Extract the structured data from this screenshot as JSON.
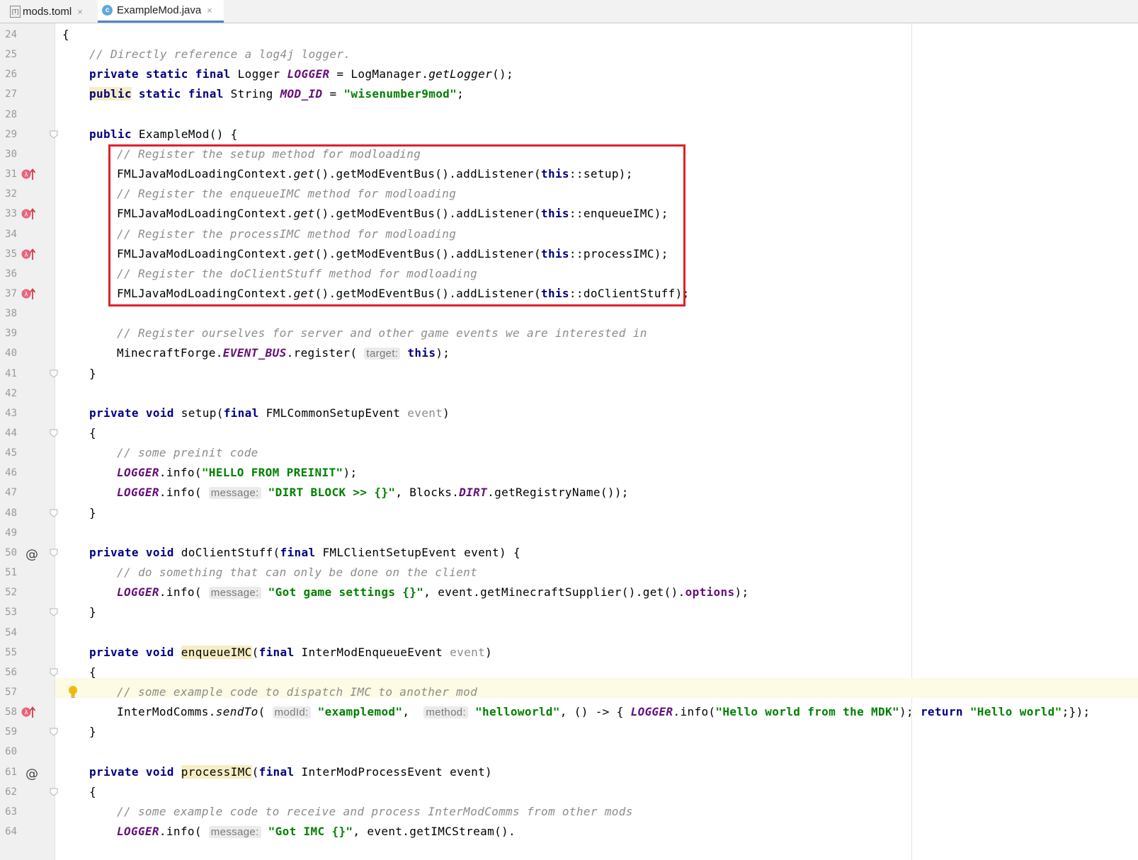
{
  "tabs": [
    {
      "label": "mods.toml",
      "icon": "toml-file-icon",
      "close": "×"
    },
    {
      "label": "ExampleMod.java",
      "icon": "java-class-icon",
      "close": "×",
      "active": true
    }
  ],
  "colors": {
    "keyword": "#000080",
    "string": "#008000",
    "comment": "#8c8c8c",
    "static_field": "#660e7a",
    "highlight_box": "#e0202a"
  },
  "lines": [
    {
      "n": "24",
      "indent": 0,
      "parts": [
        {
          "t": "{"
        }
      ]
    },
    {
      "n": "25",
      "indent": 1,
      "parts": [
        {
          "t": "// Directly reference a log4j logger.",
          "c": "cmt"
        }
      ]
    },
    {
      "n": "26",
      "indent": 1,
      "parts": [
        {
          "t": "private static final",
          "c": "kw"
        },
        {
          "t": " Logger "
        },
        {
          "t": "LOGGER",
          "c": "sf"
        },
        {
          "t": " = LogManager."
        },
        {
          "t": "getLogger",
          "c": "it"
        },
        {
          "t": "();"
        }
      ]
    },
    {
      "n": "27",
      "indent": 1,
      "parts": [
        {
          "t": "public",
          "c": "kw hlw"
        },
        {
          "t": " static final",
          "c": "kw"
        },
        {
          "t": " String "
        },
        {
          "t": "MOD_ID",
          "c": "sf"
        },
        {
          "t": " = "
        },
        {
          "t": "\"wisenumber9mod\"",
          "c": "str"
        },
        {
          "t": ";"
        }
      ]
    },
    {
      "n": "28",
      "indent": 0,
      "parts": []
    },
    {
      "n": "29",
      "indent": 1,
      "fold": true,
      "parts": [
        {
          "t": "public",
          "c": "kw"
        },
        {
          "t": " ExampleMod() {"
        }
      ]
    },
    {
      "n": "30",
      "indent": 2,
      "parts": [
        {
          "t": "// Register the setup method for modloading",
          "c": "cmt"
        }
      ]
    },
    {
      "n": "31",
      "indent": 2,
      "gutter": "lambda",
      "parts": [
        {
          "t": "FMLJavaModLoadingContext."
        },
        {
          "t": "get",
          "c": "it"
        },
        {
          "t": "().getModEventBus().addListener("
        },
        {
          "t": "this",
          "c": "kw"
        },
        {
          "t": "::setup);"
        }
      ]
    },
    {
      "n": "32",
      "indent": 2,
      "parts": [
        {
          "t": "// Register the enqueueIMC method for modloading",
          "c": "cmt"
        }
      ]
    },
    {
      "n": "33",
      "indent": 2,
      "gutter": "lambda",
      "parts": [
        {
          "t": "FMLJavaModLoadingContext."
        },
        {
          "t": "get",
          "c": "it"
        },
        {
          "t": "().getModEventBus().addListener("
        },
        {
          "t": "this",
          "c": "kw"
        },
        {
          "t": "::enqueueIMC);"
        }
      ]
    },
    {
      "n": "34",
      "indent": 2,
      "parts": [
        {
          "t": "// Register the processIMC method for modloading",
          "c": "cmt"
        }
      ]
    },
    {
      "n": "35",
      "indent": 2,
      "gutter": "lambda",
      "parts": [
        {
          "t": "FMLJavaModLoadingContext."
        },
        {
          "t": "get",
          "c": "it"
        },
        {
          "t": "().getModEventBus().addListener("
        },
        {
          "t": "this",
          "c": "kw"
        },
        {
          "t": "::processIMC);"
        }
      ]
    },
    {
      "n": "36",
      "indent": 2,
      "parts": [
        {
          "t": "// Register the doClientStuff method for modloading",
          "c": "cmt"
        }
      ]
    },
    {
      "n": "37",
      "indent": 2,
      "gutter": "lambda",
      "parts": [
        {
          "t": "FMLJavaModLoadingContext."
        },
        {
          "t": "get",
          "c": "it"
        },
        {
          "t": "().getModEventBus().addListener("
        },
        {
          "t": "this",
          "c": "kw"
        },
        {
          "t": "::doClientStuff);"
        }
      ]
    },
    {
      "n": "38",
      "indent": 0,
      "parts": []
    },
    {
      "n": "39",
      "indent": 2,
      "parts": [
        {
          "t": "// Register ourselves for server and other game events we are interested in",
          "c": "cmt"
        }
      ]
    },
    {
      "n": "40",
      "indent": 2,
      "parts": [
        {
          "t": "MinecraftForge."
        },
        {
          "t": "EVENT_BUS",
          "c": "sf"
        },
        {
          "t": ".register( "
        },
        {
          "t": "target:",
          "c": "hint"
        },
        {
          "t": " "
        },
        {
          "t": "this",
          "c": "kw"
        },
        {
          "t": ");"
        }
      ]
    },
    {
      "n": "41",
      "indent": 1,
      "fold": true,
      "parts": [
        {
          "t": "}"
        }
      ]
    },
    {
      "n": "42",
      "indent": 0,
      "parts": []
    },
    {
      "n": "43",
      "indent": 1,
      "parts": [
        {
          "t": "private void",
          "c": "kw"
        },
        {
          "t": " setup("
        },
        {
          "t": "final",
          "c": "kw"
        },
        {
          "t": " FMLCommonSetupEvent "
        },
        {
          "t": "event",
          "c": "param"
        },
        {
          "t": ")"
        }
      ]
    },
    {
      "n": "44",
      "indent": 1,
      "fold": true,
      "parts": [
        {
          "t": "{"
        }
      ]
    },
    {
      "n": "45",
      "indent": 2,
      "parts": [
        {
          "t": "// some preinit code",
          "c": "cmt"
        }
      ]
    },
    {
      "n": "46",
      "indent": 2,
      "parts": [
        {
          "t": "LOGGER",
          "c": "sf"
        },
        {
          "t": ".info("
        },
        {
          "t": "\"HELLO FROM PREINIT\"",
          "c": "str"
        },
        {
          "t": ");"
        }
      ]
    },
    {
      "n": "47",
      "indent": 2,
      "parts": [
        {
          "t": "LOGGER",
          "c": "sf"
        },
        {
          "t": ".info( "
        },
        {
          "t": "message:",
          "c": "hint"
        },
        {
          "t": " "
        },
        {
          "t": "\"DIRT BLOCK >> {}\"",
          "c": "str"
        },
        {
          "t": ", Blocks."
        },
        {
          "t": "DIRT",
          "c": "sf"
        },
        {
          "t": ".getRegistryName());"
        }
      ]
    },
    {
      "n": "48",
      "indent": 1,
      "fold": true,
      "parts": [
        {
          "t": "}"
        }
      ]
    },
    {
      "n": "49",
      "indent": 0,
      "parts": []
    },
    {
      "n": "50",
      "indent": 1,
      "gutter": "at",
      "fold": true,
      "parts": [
        {
          "t": "private void",
          "c": "kw"
        },
        {
          "t": " doClientStuff("
        },
        {
          "t": "final",
          "c": "kw"
        },
        {
          "t": " FMLClientSetupEvent event) {"
        }
      ]
    },
    {
      "n": "51",
      "indent": 2,
      "parts": [
        {
          "t": "// do something that can only be done on the client",
          "c": "cmt"
        }
      ]
    },
    {
      "n": "52",
      "indent": 2,
      "parts": [
        {
          "t": "LOGGER",
          "c": "sf"
        },
        {
          "t": ".info( "
        },
        {
          "t": "message:",
          "c": "hint"
        },
        {
          "t": " "
        },
        {
          "t": "\"Got game settings {}\"",
          "c": "str"
        },
        {
          "t": ", event.getMinecraftSupplier().get()."
        },
        {
          "t": "options",
          "c": "fieldref"
        },
        {
          "t": ");"
        }
      ]
    },
    {
      "n": "53",
      "indent": 1,
      "fold": true,
      "parts": [
        {
          "t": "}"
        }
      ]
    },
    {
      "n": "54",
      "indent": 0,
      "parts": []
    },
    {
      "n": "55",
      "indent": 1,
      "parts": [
        {
          "t": "private void",
          "c": "kw"
        },
        {
          "t": " "
        },
        {
          "t": "enqueueIMC",
          "c": "hlw"
        },
        {
          "t": "("
        },
        {
          "t": "final",
          "c": "kw"
        },
        {
          "t": " InterModEnqueueEvent "
        },
        {
          "t": "event",
          "c": "param"
        },
        {
          "t": ")"
        }
      ]
    },
    {
      "n": "56",
      "indent": 1,
      "fold": true,
      "parts": [
        {
          "t": "{"
        }
      ]
    },
    {
      "n": "57",
      "indent": 2,
      "gutter": "bulb",
      "parts": [
        {
          "t": "// some example code to dispatch IMC to another mod",
          "c": "cmt"
        }
      ]
    },
    {
      "n": "58",
      "indent": 2,
      "gutter": "lambda",
      "parts": [
        {
          "t": "InterModComms."
        },
        {
          "t": "sendTo",
          "c": "it"
        },
        {
          "t": "( "
        },
        {
          "t": "modId:",
          "c": "hint"
        },
        {
          "t": " "
        },
        {
          "t": "\"examplemod\"",
          "c": "str"
        },
        {
          "t": ",  "
        },
        {
          "t": "method:",
          "c": "hint"
        },
        {
          "t": " "
        },
        {
          "t": "\"helloworld\"",
          "c": "str"
        },
        {
          "t": ", () -> { "
        },
        {
          "t": "LOGGER",
          "c": "sf"
        },
        {
          "t": ".info("
        },
        {
          "t": "\"Hello world from the MDK\"",
          "c": "str"
        },
        {
          "t": "); "
        },
        {
          "t": "return",
          "c": "kw"
        },
        {
          "t": " "
        },
        {
          "t": "\"Hello world\"",
          "c": "str"
        },
        {
          "t": ";});"
        }
      ]
    },
    {
      "n": "59",
      "indent": 1,
      "fold": true,
      "parts": [
        {
          "t": "}"
        }
      ]
    },
    {
      "n": "60",
      "indent": 0,
      "parts": []
    },
    {
      "n": "61",
      "indent": 1,
      "gutter": "at",
      "parts": [
        {
          "t": "private void",
          "c": "kw"
        },
        {
          "t": " "
        },
        {
          "t": "processIMC",
          "c": "hlw"
        },
        {
          "t": "("
        },
        {
          "t": "final",
          "c": "kw"
        },
        {
          "t": " InterModProcessEvent event)"
        }
      ]
    },
    {
      "n": "62",
      "indent": 1,
      "fold": true,
      "parts": [
        {
          "t": "{"
        }
      ]
    },
    {
      "n": "63",
      "indent": 2,
      "parts": [
        {
          "t": "// some example code to receive and process InterModComms from other mods",
          "c": "cmt"
        }
      ]
    },
    {
      "n": "64",
      "indent": 2,
      "parts": [
        {
          "t": "LOGGER",
          "c": "sf"
        },
        {
          "t": ".info( "
        },
        {
          "t": "message:",
          "c": "hint"
        },
        {
          "t": " "
        },
        {
          "t": "\"Got IMC {}\"",
          "c": "str"
        },
        {
          "t": ", event.getIMCStream()."
        }
      ]
    }
  ]
}
